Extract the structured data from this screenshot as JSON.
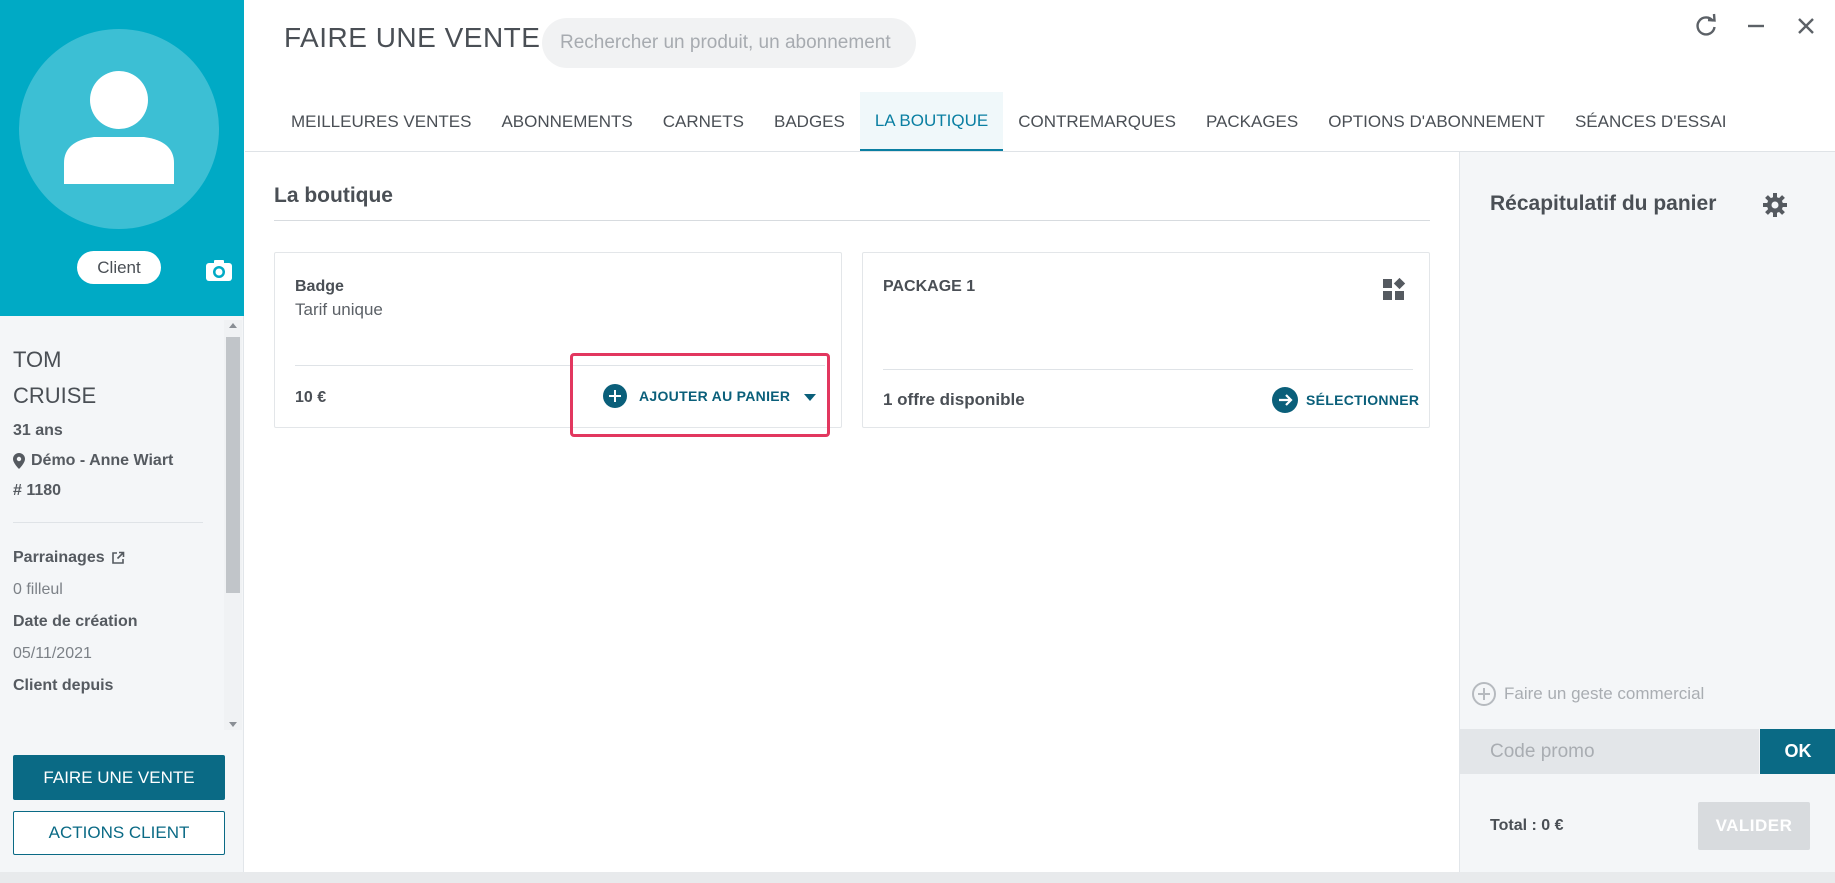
{
  "client": {
    "role_label": "Client",
    "first_name": "TOM",
    "last_name": "CRUISE",
    "age": "31 ans",
    "location": "Démo - Anne Wiart",
    "member_id": "# 1180",
    "referrals_label": "Parrainages",
    "referrals_value": "0 filleul",
    "creation_label": "Date de création",
    "creation_value": "05/11/2021",
    "since_label": "Client depuis",
    "primary_button": "FAIRE UNE VENTE",
    "secondary_button": "ACTIONS CLIENT"
  },
  "header": {
    "title": "FAIRE UNE VENTE",
    "search_placeholder": "Rechercher un produit, un abonnement"
  },
  "tabs": [
    {
      "label": "MEILLEURES VENTES",
      "active": false
    },
    {
      "label": "ABONNEMENTS",
      "active": false
    },
    {
      "label": "CARNETS",
      "active": false
    },
    {
      "label": "BADGES",
      "active": false
    },
    {
      "label": "LA BOUTIQUE",
      "active": true
    },
    {
      "label": "CONTREMARQUES",
      "active": false
    },
    {
      "label": "PACKAGES",
      "active": false
    },
    {
      "label": "OPTIONS D'ABONNEMENT",
      "active": false
    },
    {
      "label": "SÉANCES D'ESSAI",
      "active": false
    }
  ],
  "main": {
    "section_title": "La boutique",
    "products": [
      {
        "name": "Badge",
        "subtitle": "Tarif unique",
        "price": "10 €",
        "action_label": "AJOUTER AU PANIER"
      },
      {
        "name": "PACKAGE 1",
        "offers": "1 offre disponible",
        "action_label": "SÉLECTIONNER"
      }
    ]
  },
  "cart": {
    "title": "Récapitulatif du panier",
    "gesture_label": "Faire un geste commercial",
    "promo_placeholder": "Code promo",
    "ok_label": "OK",
    "total": "Total : 0 €",
    "validate_label": "VALIDER"
  },
  "colors": {
    "brand_teal": "#00aac5",
    "primary_dark": "#0a6a85",
    "highlight": "#e2375f"
  }
}
